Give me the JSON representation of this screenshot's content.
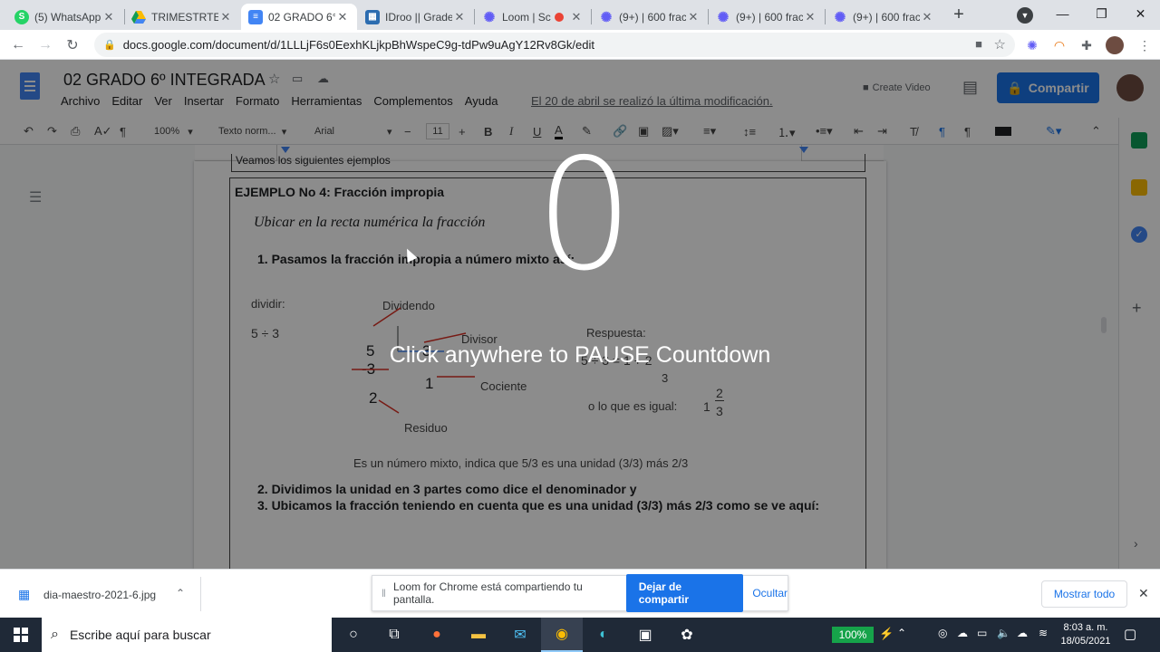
{
  "tabs": [
    {
      "title": "(5) WhatsApp",
      "icon": "whatsapp-icon",
      "color": "#25d366",
      "active": false
    },
    {
      "title": "TRIMESTRTE I",
      "icon": "google-drive-icon",
      "color": "#1fa463",
      "active": false
    },
    {
      "title": "02 GRADO 6°",
      "icon": "google-docs-icon",
      "color": "#4285f4",
      "active": true
    },
    {
      "title": "IDroo || Grade",
      "icon": "idroo-icon",
      "color": "#2b6cb0",
      "active": false
    },
    {
      "title": "Loom | Sc",
      "icon": "loom-icon",
      "color": "#625df5",
      "active": false
    },
    {
      "title": "(9+) | 600 frac",
      "icon": "loom-icon",
      "color": "#625df5",
      "active": false
    },
    {
      "title": "(9+) | 600 frac",
      "icon": "loom-icon",
      "color": "#625df5",
      "active": false
    },
    {
      "title": "(9+) | 600 frac",
      "icon": "loom-icon",
      "color": "#625df5",
      "active": false
    }
  ],
  "address": {
    "url": "docs.google.com/document/d/1LLLjF6s0EexhKLjkpBhWspeC9g-tdPw9uAgY12Rv8Gk/edit"
  },
  "doc": {
    "title": "02 GRADO 6º  INTEGRADA",
    "menu": [
      "Archivo",
      "Editar",
      "Ver",
      "Insertar",
      "Formato",
      "Herramientas",
      "Complementos",
      "Ayuda"
    ],
    "last_edit": "El 20 de abril se realizó la última modificación.",
    "create_video": "Create Video",
    "share": "Compartir",
    "zoom": "100%",
    "style": "Texto norm...",
    "font": "Arial",
    "font_size": "11",
    "content": {
      "top_line": "Veamos los siguientes ejemplos",
      "heading": "EJEMPLO No 4: Fracción impropia",
      "italic": "Ubicar en la recta numérica la fracción",
      "step1": "1.   Pasamos la fracción impropia a número mixto así:",
      "dividir": "dividir:",
      "division": "5 ÷ 3",
      "dividendo": "Dividendo",
      "divisor": "Divisor",
      "cociente": "Cociente",
      "residuo": "Residuo",
      "n5": "5",
      "n3": "3",
      "nminus3": "-3",
      "n1": "1",
      "n2": "2",
      "respuesta": "Respuesta:",
      "eq": "5 ÷ 3  =  1 + 2",
      "eq_den": "3",
      "lo_que": "o lo que es igual:",
      "mixed_whole": "1",
      "mixed_num": "2",
      "mixed_den": "3",
      "explain": "Es un número mixto, indica que 5/3 es una unidad (3/3) más 2/3",
      "step2": "2.   Dividimos la unidad en 3 partes como dice el denominador y",
      "step3": "3.   Ubicamos la fracción teniendo en cuenta que es una unidad (3/3) más 2/3 como se ve aquí:"
    }
  },
  "overlay": {
    "countdown": "0",
    "message": "Click anywhere to PAUSE Countdown"
  },
  "download": {
    "file": "dia-maestro-2021-6.jpg",
    "show_all": "Mostrar todo"
  },
  "loom": {
    "message": "Loom for Chrome está compartiendo tu pantalla.",
    "stop": "Dejar de compartir",
    "hide": "Ocultar"
  },
  "taskbar": {
    "search": "Escribe aquí para buscar",
    "battery": "100%",
    "time": "8:03 a. m.",
    "date": "18/05/2021"
  }
}
